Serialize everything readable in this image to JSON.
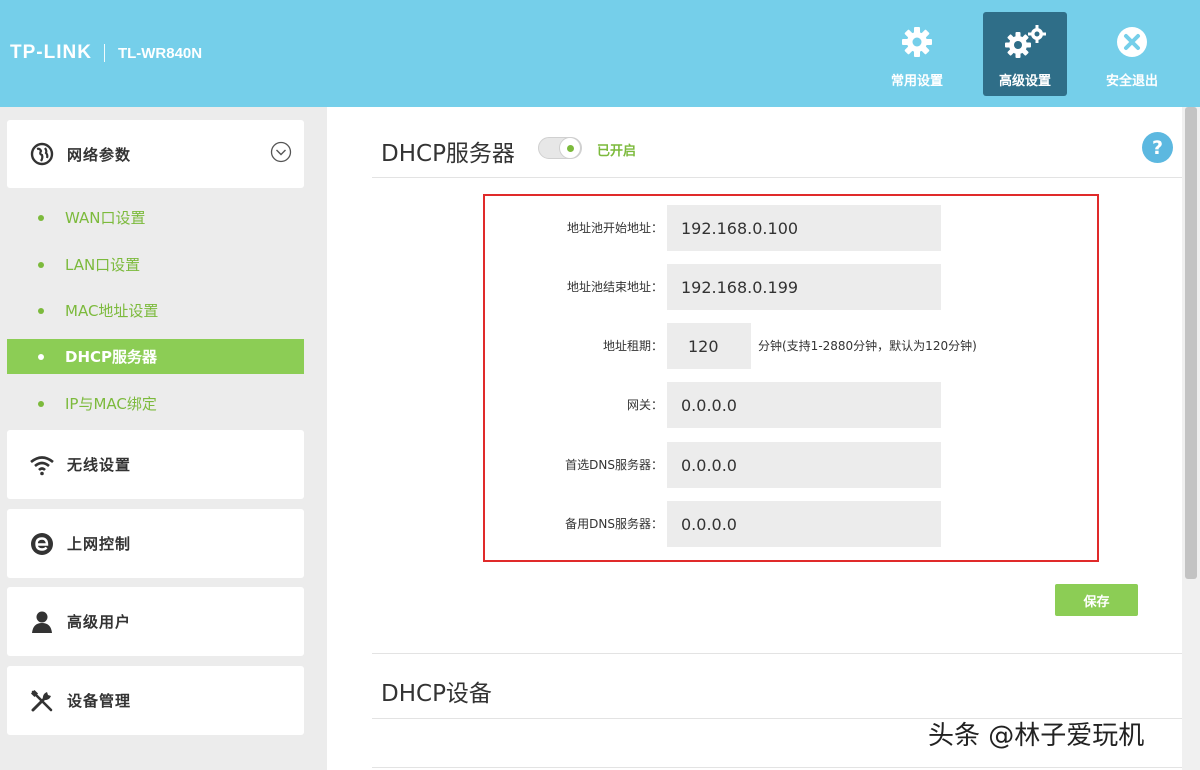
{
  "header": {
    "brand": "TP-LINK",
    "model": "TL-WR840N",
    "buttons": [
      {
        "label": "常用设置",
        "icon": "gear-icon"
      },
      {
        "label": "高级设置",
        "icon": "gears-icon",
        "active": true
      },
      {
        "label": "安全退出",
        "icon": "close-circle-icon"
      }
    ]
  },
  "sidebar": {
    "network": {
      "label": "网络参数",
      "icon": "globe-icon",
      "expanded": true
    },
    "sub_items": [
      {
        "label": "WAN口设置",
        "active": false
      },
      {
        "label": "LAN口设置",
        "active": false
      },
      {
        "label": "MAC地址设置",
        "active": false
      },
      {
        "label": "DHCP服务器",
        "active": true
      },
      {
        "label": "IP与MAC绑定",
        "active": false
      }
    ],
    "cards": [
      {
        "label": "无线设置",
        "icon": "wifi-icon"
      },
      {
        "label": "上网控制",
        "icon": "internet-e-icon"
      },
      {
        "label": "高级用户",
        "icon": "user-icon"
      },
      {
        "label": "设备管理",
        "icon": "tools-icon"
      }
    ]
  },
  "main": {
    "dhcp_title": "DHCP服务器",
    "toggle_status": "已开启",
    "help": "?",
    "fields": {
      "pool_start": {
        "label": "地址池开始地址：",
        "value": "192.168.0.100"
      },
      "pool_end": {
        "label": "地址池结束地址：",
        "value": "192.168.0.199"
      },
      "lease": {
        "label": "地址租期：",
        "value": "120",
        "note": "分钟(支持1-2880分钟，默认为120分钟)"
      },
      "gateway": {
        "label": "网关：",
        "value": "0.0.0.0"
      },
      "dns_primary": {
        "label": "首选DNS服务器：",
        "value": "0.0.0.0"
      },
      "dns_secondary": {
        "label": "备用DNS服务器：",
        "value": "0.0.0.0"
      }
    },
    "save_label": "保存",
    "devices_title": "DHCP设备"
  },
  "watermark": "头条 @林子爱玩机",
  "colors": {
    "header": "#75cfea",
    "accent_green": "#8ccd55",
    "text_green": "#7cba3c",
    "highlight_red": "#e02a2a",
    "help_blue": "#5cb8e0"
  }
}
